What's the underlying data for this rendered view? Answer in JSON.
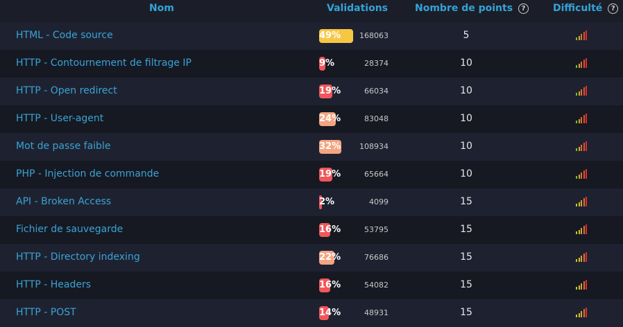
{
  "header": {
    "nom": "Nom",
    "validations": "Validations",
    "points": "Nombre de points",
    "difficulte": "Difficulté",
    "help_icon": "?"
  },
  "colors": {
    "link": "#3aa3d6",
    "bar_high": "#f7c744",
    "bar_mid": "#f4a582",
    "bar_low": "#f0575b"
  },
  "rows": [
    {
      "name": "HTML - Code source",
      "pct": "49%",
      "count": "168063",
      "points": "5",
      "level": 0.49,
      "color": "#f7c744",
      "difficulty": "very-easy"
    },
    {
      "name": "HTTP - Contournement de filtrage IP",
      "pct": "9%",
      "count": "28374",
      "points": "10",
      "level": 0.09,
      "color": "#f0575b",
      "difficulty": "very-easy"
    },
    {
      "name": "HTTP - Open redirect",
      "pct": "19%",
      "count": "66034",
      "points": "10",
      "level": 0.19,
      "color": "#f0575b",
      "difficulty": "very-easy"
    },
    {
      "name": "HTTP - User-agent",
      "pct": "24%",
      "count": "83048",
      "points": "10",
      "level": 0.24,
      "color": "#f4a582",
      "difficulty": "very-easy"
    },
    {
      "name": "Mot de passe faible",
      "pct": "32%",
      "count": "108934",
      "points": "10",
      "level": 0.32,
      "color": "#f4a582",
      "difficulty": "very-easy"
    },
    {
      "name": "PHP - Injection de commande",
      "pct": "19%",
      "count": "65664",
      "points": "10",
      "level": 0.19,
      "color": "#f0575b",
      "difficulty": "very-easy"
    },
    {
      "name": "API - Broken Access",
      "pct": "2%",
      "count": "4099",
      "points": "15",
      "level": 0.02,
      "color": "#f0575b",
      "difficulty": "easy"
    },
    {
      "name": "Fichier de sauvegarde",
      "pct": "16%",
      "count": "53795",
      "points": "15",
      "level": 0.16,
      "color": "#f0575b",
      "difficulty": "easy"
    },
    {
      "name": "HTTP - Directory indexing",
      "pct": "22%",
      "count": "76686",
      "points": "15",
      "level": 0.22,
      "color": "#f4a582",
      "difficulty": "easy"
    },
    {
      "name": "HTTP - Headers",
      "pct": "16%",
      "count": "54082",
      "points": "15",
      "level": 0.16,
      "color": "#f0575b",
      "difficulty": "easy"
    },
    {
      "name": "HTTP - POST",
      "pct": "14%",
      "count": "48931",
      "points": "15",
      "level": 0.14,
      "color": "#f0575b",
      "difficulty": "easy"
    }
  ]
}
